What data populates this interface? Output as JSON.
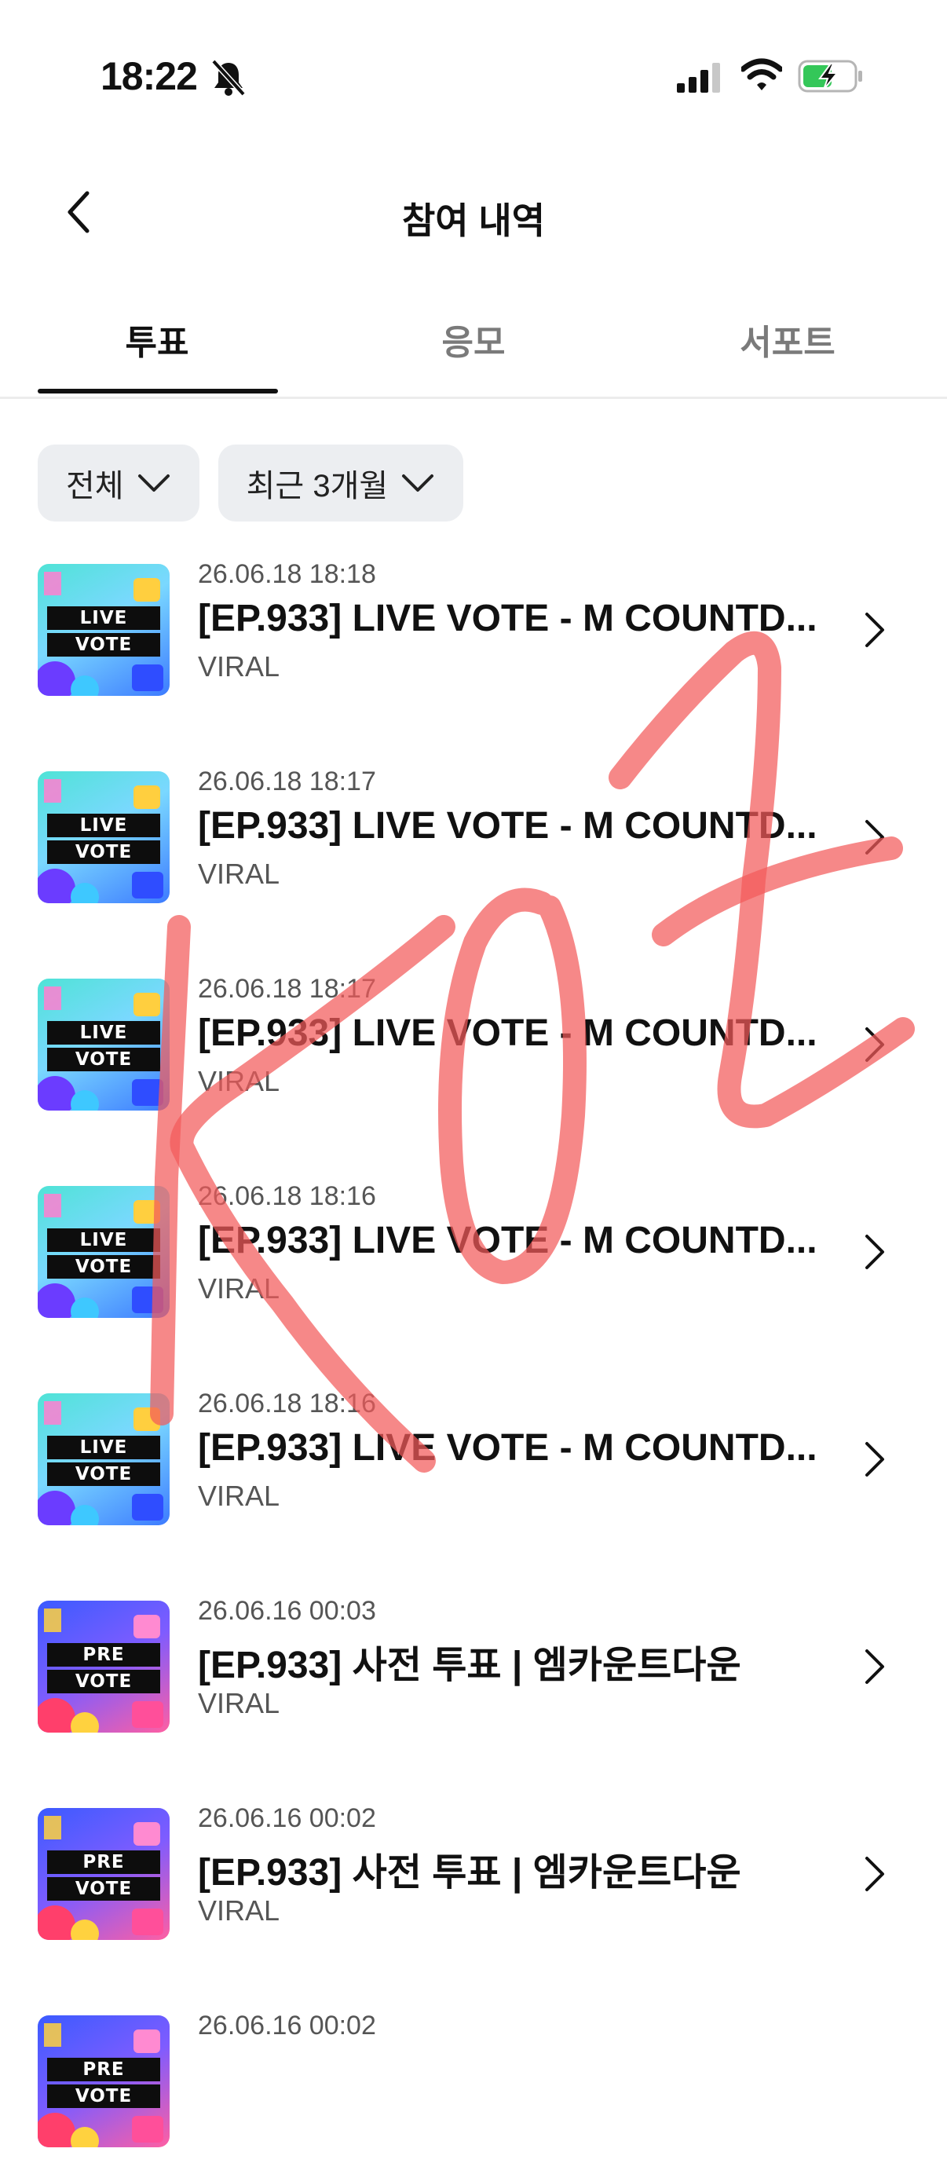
{
  "status_bar": {
    "time": "18:22"
  },
  "header": {
    "title": "참여 내역"
  },
  "tabs": [
    {
      "label": "투표",
      "active": true
    },
    {
      "label": "응모",
      "active": false
    },
    {
      "label": "서포트",
      "active": false
    }
  ],
  "filters": {
    "type": {
      "label": "전체"
    },
    "period": {
      "label": "최근 3개월"
    }
  },
  "items": [
    {
      "date": "26.06.18 18:18",
      "title": "[EP.933] LIVE VOTE - M COUNTD...",
      "sub": "VIRAL",
      "badge_top": "LIVE",
      "badge_bottom": "VOTE",
      "kind": "live"
    },
    {
      "date": "26.06.18 18:17",
      "title": "[EP.933] LIVE VOTE - M COUNTD...",
      "sub": "VIRAL",
      "badge_top": "LIVE",
      "badge_bottom": "VOTE",
      "kind": "live"
    },
    {
      "date": "26.06.18 18:17",
      "title": "[EP.933] LIVE VOTE - M COUNTD...",
      "sub": "VIRAL",
      "badge_top": "LIVE",
      "badge_bottom": "VOTE",
      "kind": "live"
    },
    {
      "date": "26.06.18 18:16",
      "title": "[EP.933] LIVE VOTE - M COUNTD...",
      "sub": "VIRAL",
      "badge_top": "LIVE",
      "badge_bottom": "VOTE",
      "kind": "live"
    },
    {
      "date": "26.06.18 18:16",
      "title": "[EP.933] LIVE VOTE - M COUNTD...",
      "sub": "VIRAL",
      "badge_top": "LIVE",
      "badge_bottom": "VOTE",
      "kind": "live"
    },
    {
      "date": "26.06.16 00:03",
      "title": "[EP.933] 사전 투표 | 엠카운트다운",
      "sub": "VIRAL",
      "badge_top": "PRE",
      "badge_bottom": "VOTE",
      "kind": "pre"
    },
    {
      "date": "26.06.16 00:02",
      "title": "[EP.933] 사전 투표 | 엠카운트다운",
      "sub": "VIRAL",
      "badge_top": "PRE",
      "badge_bottom": "VOTE",
      "kind": "pre"
    },
    {
      "date": "26.06.16 00:02",
      "title": "",
      "sub": "",
      "badge_top": "PRE",
      "badge_bottom": "VOTE",
      "kind": "pre"
    }
  ],
  "colors": {
    "accent": "#111111",
    "chip_bg": "#eceef1",
    "live_bg_a": "#4fe3d6",
    "live_bg_b": "#3d7bff",
    "pre_bg_a": "#3b5bff",
    "pre_bg_b": "#ff5fa2",
    "scribble": "#f25a5a"
  },
  "icons": {
    "back": "chevron-left-icon",
    "bell": "bell-slash-icon",
    "signal": "cellular-signal-icon",
    "wifi": "wifi-icon",
    "battery": "battery-charging-icon",
    "row_chevron": "chevron-right-icon"
  }
}
